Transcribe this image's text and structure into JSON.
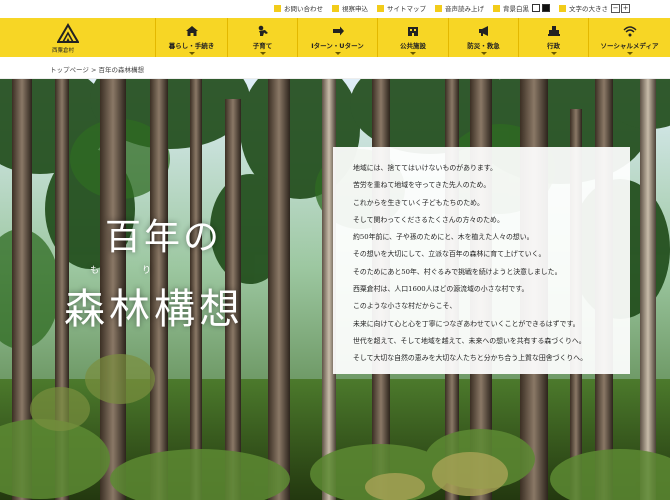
{
  "utility": {
    "contact": "お問い合わせ",
    "inspection": "視察申込",
    "sitemap": "サイトマップ",
    "speech": "音声読み上げ",
    "bg_color": "背景白黒",
    "font_size": "文字の大きさ",
    "minus": "−",
    "plus": "+"
  },
  "logo": {
    "name": "西粟倉村"
  },
  "nav": [
    {
      "label": "暮らし・手続き",
      "icon": "house-icon"
    },
    {
      "label": "子育て",
      "icon": "child-icon"
    },
    {
      "label": "Iターン・Uターン",
      "icon": "arrow-icon"
    },
    {
      "label": "公共施設",
      "icon": "building-icon"
    },
    {
      "label": "防災・救急",
      "icon": "megaphone-icon"
    },
    {
      "label": "行政",
      "icon": "government-icon"
    },
    {
      "label": "ソーシャルメディア",
      "icon": "wifi-icon"
    }
  ],
  "breadcrumb": {
    "home": "トップページ",
    "separator": " > ",
    "current": "百年の森林構想"
  },
  "hero": {
    "title_line1": "百年の",
    "title_line2": "森林構想",
    "ruby_mo": "も",
    "ruby_ri": "り"
  },
  "message": [
    "地域には、捨ててはいけないものがあります。",
    "苦労を重ねて地域を守ってきた先人のため。",
    "これからを生きていく子どもたちのため。",
    "そして関わってくださるたくさんの方々のため。",
    "約50年前に、子や孫のためにと、木を植えた人々の想い。",
    "その想いを大切にして、立派な百年の森林に育て上げていく。",
    "そのためにあと50年、村ぐるみで挑戦を続けようと決意しました。",
    "西粟倉村は、人口1600人ほどの源流域の小さな村です。",
    "このような小さな村だからこそ、",
    "未来に向けて心と心を丁寧につなぎあわせていくことができるはずです。",
    "世代を超えて、そして地域を越えて、未来への想いを共有する森づくりへ。",
    "そして大切な自然の恵みを大切な人たちと分かち合う上質な田舎づくりへ。"
  ],
  "colors": {
    "header": "#f7d625",
    "accent_square": "#f2cc1a"
  }
}
